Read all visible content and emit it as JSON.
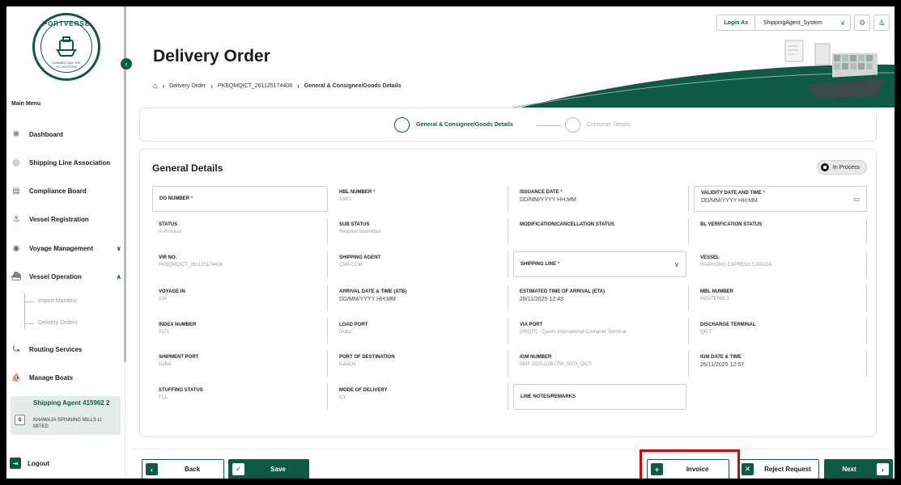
{
  "brand": {
    "logo_top": "PORTVERSE",
    "logo_bottom": "CONNECTING THE ECOSYSTEM"
  },
  "sidebar": {
    "menu_title": "Main Menu",
    "items": [
      {
        "label": "Dashboard",
        "icon": "dashboard-icon"
      },
      {
        "label": "Shipping Line Association",
        "icon": "shipping-line-icon"
      },
      {
        "label": "Compliance Board",
        "icon": "compliance-icon"
      },
      {
        "label": "Vessel Registration",
        "icon": "vessel-registration-icon"
      },
      {
        "label": "Voyage Management",
        "icon": "voyage-icon"
      },
      {
        "label": "Vessel Operation",
        "icon": "vessel-operation-icon"
      },
      {
        "label": "Routing Services",
        "icon": "routing-icon"
      },
      {
        "label": "Manage Boats",
        "icon": "boat-icon"
      }
    ],
    "sub_items": [
      "Import Manifest",
      "Delivery Orders"
    ],
    "agent": {
      "initial": "S",
      "name": "Shipping Agent 415962 2",
      "company": "KHAWAJA SPINNING MILLS LI MITED"
    },
    "logout": "Logout"
  },
  "topbar": {
    "login_as": "Login As",
    "role": "ShippingAgent_System"
  },
  "header": {
    "title": "Delivery Order",
    "breadcrumb": [
      "Delivery Order",
      "PKBQMQICT_261125174408",
      "General & Consignee/Goods Details"
    ]
  },
  "stepper": {
    "steps": [
      "General & Consignee/Goods Details",
      "Container Details"
    ]
  },
  "details": {
    "title": "General Details",
    "status_chip": "In Process",
    "fields": {
      "do_number": {
        "label": "DO NUMBER",
        "value": ""
      },
      "hbl_number": {
        "label": "HBL NUMBER",
        "value": "AA01"
      },
      "issuance_date": {
        "label": "ISSUANCE DATE",
        "value": "DD/MM/YYYY HH:MM"
      },
      "validity_date": {
        "label": "VALIDITY DATE AND TIME",
        "value": "DD/MM/YYYY HH:MM"
      },
      "status": {
        "label": "STATUS",
        "value": "In Process"
      },
      "sub_status": {
        "label": "SUB STATUS",
        "value": "Request Submitted"
      },
      "modification_status": {
        "label": "MODIFICATION/CANCELLATION STATUS",
        "value": ""
      },
      "bl_verification": {
        "label": "BL VERIFICATION STATUS",
        "value": ""
      },
      "vir_no": {
        "label": "VIR NO.",
        "value": "PKBQMQICT_261125174408"
      },
      "shipping_agent": {
        "label": "SHIPPING AGENT",
        "value": "CMA CGM"
      },
      "shipping_line": {
        "label": "SHIPPING LINE",
        "value": ""
      },
      "vessel": {
        "label": "VESSEL",
        "value": "HAIPHONG EXPRESS CANADA"
      },
      "voyage_in": {
        "label": "VOYAGE IN",
        "value": "234"
      },
      "arrival_date": {
        "label": "ARRIVAL DATE & TIME (ATB)",
        "value": "DD/MM/YYYY HH:MM"
      },
      "eta": {
        "label": "ESTIMATED TIME OF ARRIVAL (ETA)",
        "value": "28/11/2025 12:43"
      },
      "mbl_number": {
        "label": "MBL NUMBER",
        "value": "MASTERBL1"
      },
      "index_number": {
        "label": "INDEX NUMBER",
        "value": "3171"
      },
      "load_port": {
        "label": "LOAD PORT",
        "value": "Dubai"
      },
      "via_port": {
        "label": "VIA PORT",
        "value": "(PKQIT) - Qasim International Container Terminal"
      },
      "discharge_terminal": {
        "label": "DISCHARGE TERMINAL",
        "value": "QICT"
      },
      "shipment_port": {
        "label": "SHIPMENT PORT",
        "value": "Dubai"
      },
      "port_destination": {
        "label": "PORT OF DESTINATION",
        "value": "Karachi"
      },
      "igm_number": {
        "label": "IGM NUMBER",
        "value": "MNF-202511261756_0003_QICT"
      },
      "igm_date": {
        "label": "IGM DATE & TIME",
        "value": "26/11/2025 12:57"
      },
      "stuffing_status": {
        "label": "STUFFING STATUS",
        "value": "FCL"
      },
      "mode_delivery": {
        "label": "MODE OF DELIVERY",
        "value": "CY"
      },
      "line_notes": {
        "label": "LINE NOTES/REMARKS",
        "value": ""
      }
    }
  },
  "footer": {
    "back": "Back",
    "save": "Save",
    "invoice": "Invoice",
    "reject": "Reject Request",
    "next": "Next"
  },
  "colors": {
    "brand": "#0e5a44",
    "highlight": "#e10000"
  }
}
